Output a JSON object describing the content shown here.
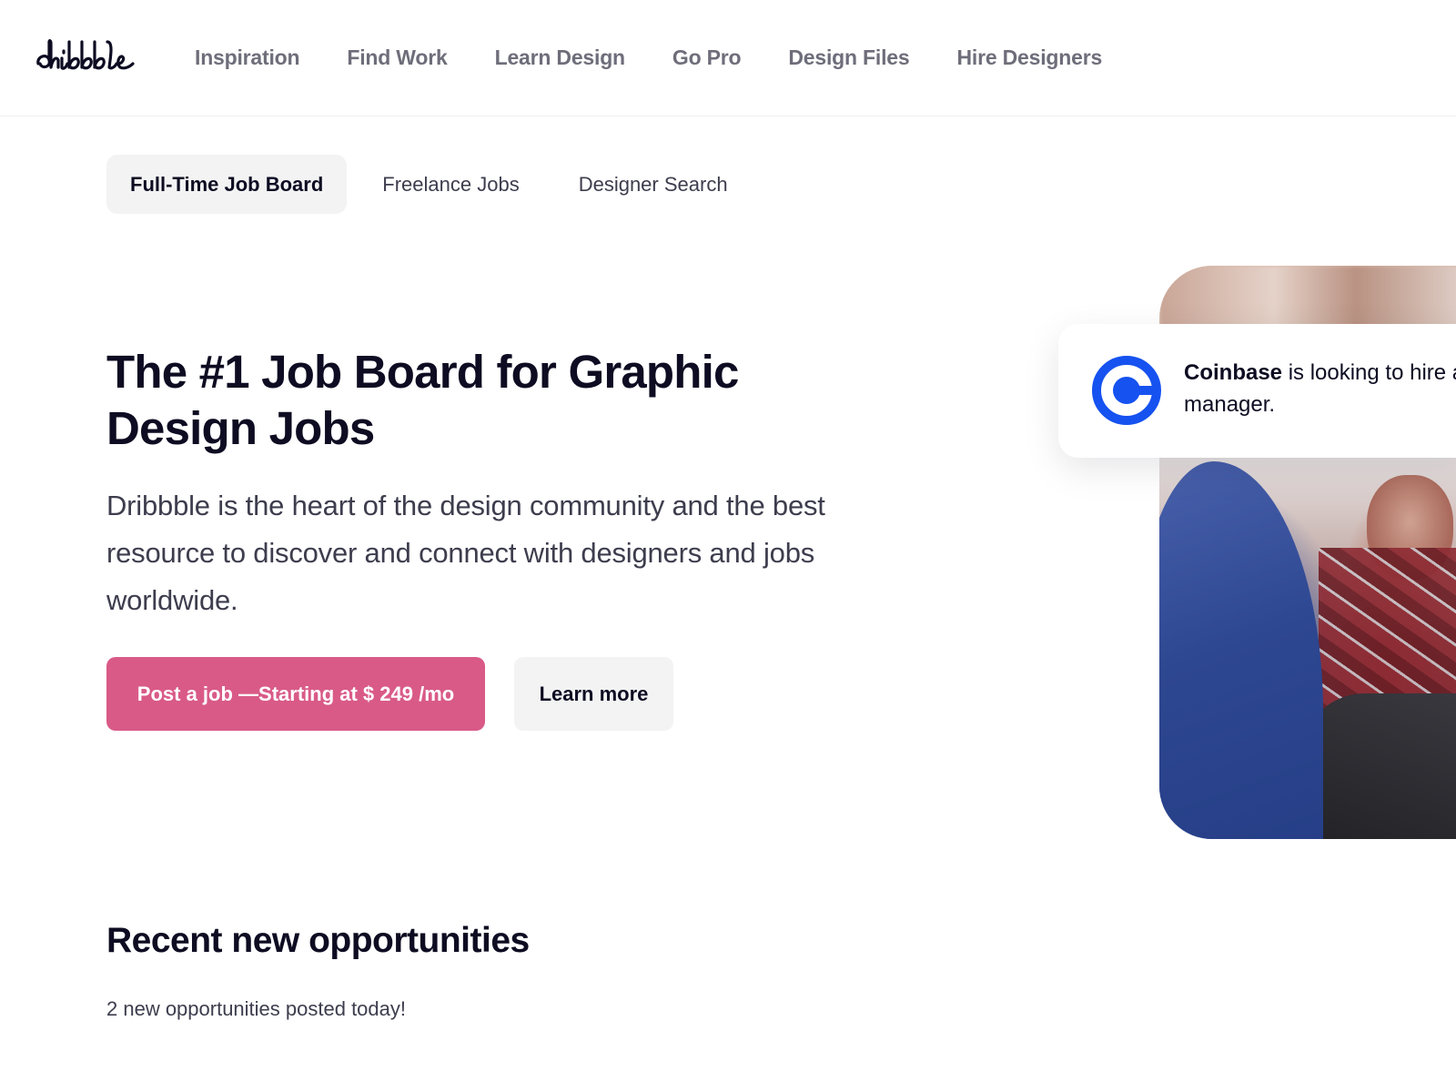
{
  "brand": {
    "logo_text": "dribbble",
    "accent_color": "#d95a87"
  },
  "nav": {
    "items": [
      {
        "label": "Inspiration"
      },
      {
        "label": "Find Work"
      },
      {
        "label": "Learn Design"
      },
      {
        "label": "Go Pro"
      },
      {
        "label": "Design Files"
      },
      {
        "label": "Hire Designers"
      }
    ]
  },
  "subtabs": [
    {
      "label": "Full-Time Job Board",
      "active": true
    },
    {
      "label": "Freelance Jobs",
      "active": false
    },
    {
      "label": "Designer Search",
      "active": false
    }
  ],
  "hero": {
    "title": "The #1 Job Board for Graphic Design Jobs",
    "description": "Dribbble is the heart of the design community and the best resource to discover and connect with designers and jobs worldwide.",
    "primary_button": "Post a job —Starting at $ 249 /mo",
    "secondary_button": "Learn more"
  },
  "featured_card": {
    "company": "Coinbase",
    "text": " is looking to hire a product design manager.",
    "logo_icon": "coinbase-logo-icon",
    "logo_color": "#1652f0"
  },
  "recent": {
    "title": "Recent new opportunities",
    "subtitle": "2 new opportunities posted today!"
  }
}
